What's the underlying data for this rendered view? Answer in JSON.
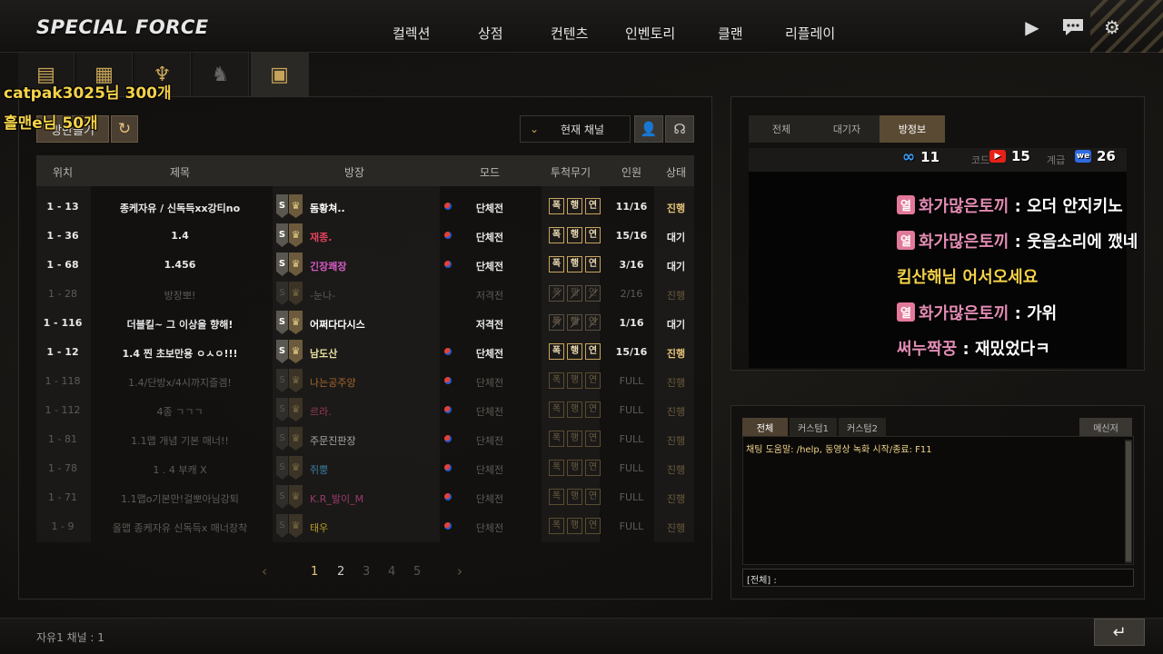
{
  "header": {
    "logo": "SPECIAL FORCE",
    "nav": [
      "컬렉션",
      "상점",
      "컨텐츠",
      "인벤토리",
      "클랜",
      "리플레이"
    ],
    "icons": [
      "play-icon",
      "chat-bubble-icon",
      "gear-icon"
    ]
  },
  "category_tabs": [
    "mission-icon",
    "calendar-icon",
    "fire-emblem-icon",
    "soldier-icon",
    "supply-box-icon"
  ],
  "donations": [
    {
      "text": "catpak3025님 300개"
    },
    {
      "text": "흘맨e님 50개"
    }
  ],
  "toolbar": {
    "quick_join_label": "방만들기",
    "channel_select": "현재 채널"
  },
  "room_table": {
    "headers": [
      "위치",
      "제목",
      "방장",
      "모드",
      "투척무기",
      "인원",
      "상태"
    ],
    "rows": [
      {
        "loc": "1 - 13",
        "title": "종케자유 / 신독득xx강티no",
        "host": "돔황쳐..",
        "host_color": "#ffffff",
        "flag": true,
        "mode": "단체전",
        "weapons": [
          "폭",
          "행",
          "연"
        ],
        "wstate": "on",
        "players": "11/16",
        "status": "진행",
        "dim": false
      },
      {
        "loc": "1 - 36",
        "title": "1.4",
        "host": "재종.",
        "host_color": "#e0415a",
        "flag": true,
        "mode": "단체전",
        "weapons": [
          "폭",
          "행",
          "연"
        ],
        "wstate": "on",
        "players": "15/16",
        "status": "대기",
        "dim": false
      },
      {
        "loc": "1 - 68",
        "title": "1.456",
        "host": "긴장쾌장",
        "host_color": "#d65bc4",
        "flag": true,
        "mode": "단체전",
        "weapons": [
          "폭",
          "행",
          "연"
        ],
        "wstate": "on",
        "players": "3/16",
        "status": "대기",
        "dim": false
      },
      {
        "loc": "1 - 28",
        "title": "방장뽀!",
        "host": "-눈나-",
        "host_color": "#5d5b56",
        "flag": false,
        "mode": "저격전",
        "weapons": [
          "폭",
          "행",
          "연"
        ],
        "wstate": "off",
        "players": "2/16",
        "status": "진행",
        "dim": true
      },
      {
        "loc": "1 - 116",
        "title": "더블킬~ 그 이상을 향해!",
        "host": "어쩌다다시스",
        "host_color": "#ffffff",
        "flag": false,
        "mode": "저격전",
        "weapons": [
          "폭",
          "행",
          "연"
        ],
        "wstate": "off",
        "players": "1/16",
        "status": "대기",
        "dim": false
      },
      {
        "loc": "1 - 12",
        "title": "1.4 찐 초보만용 ㅇㅅㅇ!!!",
        "host": "남도산",
        "host_color": "#e9e0a0",
        "flag": true,
        "mode": "단체전",
        "weapons": [
          "폭",
          "행",
          "연"
        ],
        "wstate": "on",
        "players": "15/16",
        "status": "진행",
        "dim": false
      },
      {
        "loc": "1 - 118",
        "title": "1.4/단방x/4시까지즐겜!",
        "host": "나는공주양",
        "host_color": "#a4642c",
        "flag": true,
        "mode": "단체전",
        "weapons": [
          "폭",
          "행",
          "연"
        ],
        "wstate": "dim",
        "players": "FULL",
        "status": "진행",
        "dim": true
      },
      {
        "loc": "1 - 112",
        "title": "4종 ㄱㄱㄱ",
        "host": "르라.",
        "host_color": "#9a3a5a",
        "flag": true,
        "mode": "단체전",
        "weapons": [
          "폭",
          "행",
          "연"
        ],
        "wstate": "dim",
        "players": "FULL",
        "status": "진행",
        "dim": true
      },
      {
        "loc": "1 - 81",
        "title": "1.1맵 개념 기본 매너!!",
        "host": "주문진판장",
        "host_color": "#a8a8a8",
        "flag": true,
        "mode": "단체전",
        "weapons": [
          "폭",
          "행",
          "연"
        ],
        "wstate": "dim",
        "players": "FULL",
        "status": "진행",
        "dim": true
      },
      {
        "loc": "1 - 78",
        "title": "1 . 4 부캐 X",
        "host": "쥐뿡",
        "host_color": "#3a7ea0",
        "flag": true,
        "mode": "단체전",
        "weapons": [
          "폭",
          "행",
          "연"
        ],
        "wstate": "dim",
        "players": "FULL",
        "status": "진행",
        "dim": true
      },
      {
        "loc": "1 - 71",
        "title": "1.1맵o기본만!걸뽀아님강퇴",
        "host": "K.R_발이_M",
        "host_color": "#9a3a6a",
        "flag": true,
        "mode": "단체전",
        "weapons": [
          "폭",
          "행",
          "연"
        ],
        "wstate": "dim",
        "players": "FULL",
        "status": "진행",
        "dim": true
      },
      {
        "loc": "1 - 9",
        "title": "올맵 종케자유 신독득x 매너장착",
        "host": "태우",
        "host_color": "#b89a2a",
        "flag": true,
        "mode": "단체전",
        "weapons": [
          "폭",
          "행",
          "연"
        ],
        "wstate": "dim",
        "players": "FULL",
        "status": "진행",
        "dim": true
      }
    ]
  },
  "pager": {
    "pages": [
      "1",
      "2",
      "3",
      "4",
      "5"
    ],
    "current": "1"
  },
  "room_info": {
    "tabs": [
      "전체",
      "대기자",
      "방정보"
    ],
    "active_tab": "방정보",
    "sub_headers": [
      "코드",
      "계급"
    ]
  },
  "viewers": [
    {
      "platform": "infinity-icon",
      "count": "11",
      "color": "#3aa0ff"
    },
    {
      "platform": "youtube-icon",
      "count": "15",
      "color": "#e62117"
    },
    {
      "platform": "we-icon",
      "count": "26",
      "color": "#2e6be0"
    }
  ],
  "stream_chat": [
    {
      "tag": "열",
      "nick": "화가많은토끼",
      "msg": "오더 안지키노"
    },
    {
      "tag": "열",
      "nick": "화가많은토끼",
      "msg": "웃음소리에 깼네"
    },
    {
      "tag": "",
      "nick": "",
      "msg": "킴산해님 어서오세요",
      "color": "#f5d24a"
    },
    {
      "tag": "열",
      "nick": "화가많은토끼",
      "msg": "가위"
    },
    {
      "tag": "",
      "nick": "써누짝꿍",
      "msg": "재밌었다ㅋ"
    }
  ],
  "game_chat": {
    "tabs": [
      "전체",
      "커스텀1",
      "커스텀2"
    ],
    "messenger_label": "메신저",
    "help_text": "채팅 도움말: /help, 동영상 녹화 시작/종료: F11",
    "input_prefix": "[전체] :"
  },
  "footer": {
    "status": "자유1  채널 : 1"
  }
}
